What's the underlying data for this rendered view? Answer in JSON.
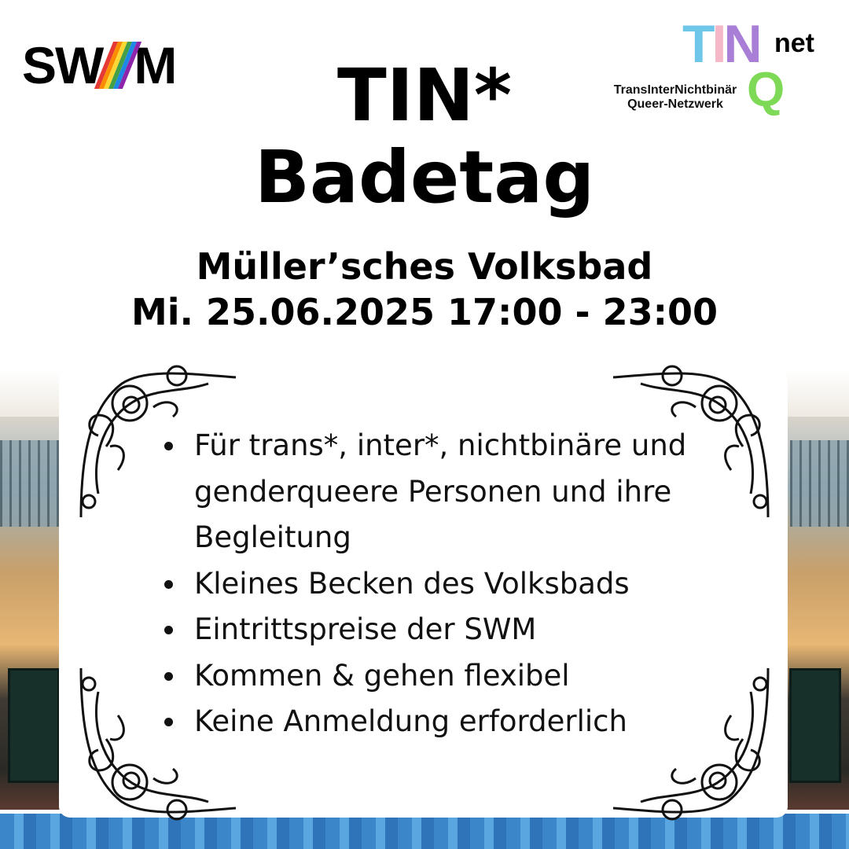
{
  "logos": {
    "swm": {
      "left": "SW",
      "right": "M",
      "stripe_colors": [
        "#e53935",
        "#fb8c00",
        "#fdd835",
        "#43a047",
        "#1e88e5",
        "#8e24aa"
      ]
    },
    "tinq": {
      "letter_t": "T",
      "letter_i": "I",
      "letter_n": "N",
      "letter_q": "Q",
      "net": "net",
      "line1": "TransInterNichtbinär",
      "line2": "Queer-Netzwerk"
    }
  },
  "title": {
    "line1": "TIN*",
    "line2": "Badetag"
  },
  "event": {
    "venue": "Müller’sches Volksbad",
    "datetime": "Mi. 25.06.2025 17:00 - 23:00"
  },
  "info_items": [
    {
      "text": "Für trans*, inter*, nichtbinäre und genderqueere Personen und ihre Begleitung"
    },
    {
      "text": "Kleines Becken des Volksbads"
    },
    {
      "text": "Eintrittspreise der SWM"
    },
    {
      "text": "Kommen & gehen flexibel"
    },
    {
      "text": "Keine Anmeldung erforderlich"
    }
  ]
}
